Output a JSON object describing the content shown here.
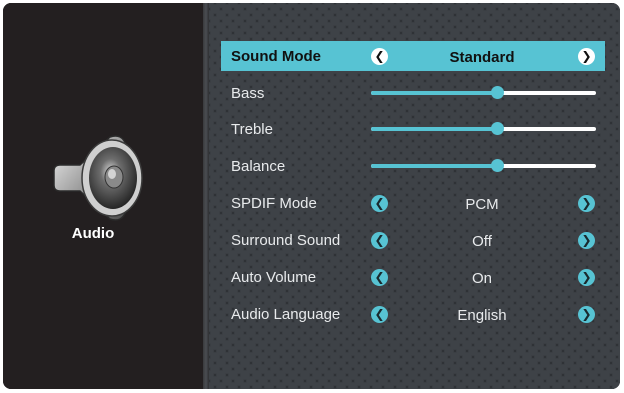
{
  "sidebar": {
    "title": "Audio",
    "icon": "speaker-icon"
  },
  "menu": {
    "sound_mode": {
      "label": "Sound Mode",
      "value": "Standard"
    },
    "bass": {
      "label": "Bass",
      "level": 0.56
    },
    "treble": {
      "label": "Treble",
      "level": 0.56
    },
    "balance": {
      "label": "Balance",
      "level": 0.56
    },
    "spdif_mode": {
      "label": "SPDIF Mode",
      "value": "PCM"
    },
    "surround_sound": {
      "label": "Surround Sound",
      "value": "Off"
    },
    "auto_volume": {
      "label": "Auto Volume",
      "value": "On"
    },
    "audio_language": {
      "label": "Audio Language",
      "value": "English"
    }
  },
  "colors": {
    "accent": "#57c3d3",
    "panel": "#231f20",
    "pattern": "#3e4247",
    "text": "#e8eaec"
  }
}
